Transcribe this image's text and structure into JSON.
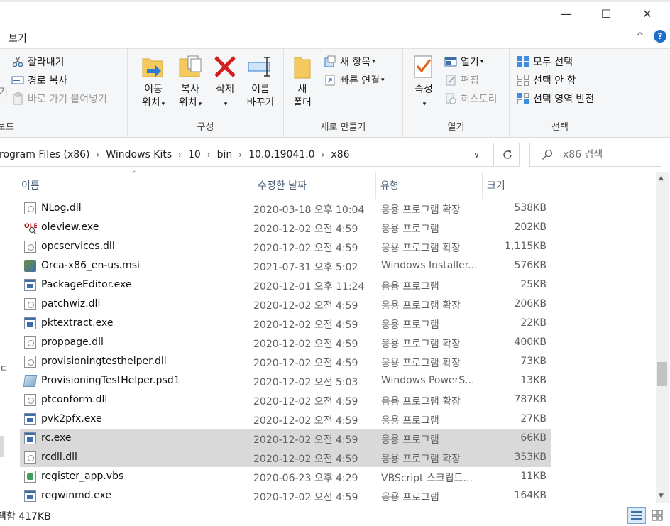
{
  "window": {
    "minimize_glyph": "—",
    "maximize_glyph": "☐",
    "close_glyph": "✕"
  },
  "ribbon_tab": {
    "active": "보기"
  },
  "ribbon": {
    "clipboard": {
      "cut": "잘라내기",
      "copy_path": "경로 복사",
      "paste_shortcut": "바로 가기 붙여넣기",
      "group_label": "보드",
      "partial_left": "기"
    },
    "organize": {
      "move_to_l1": "이동",
      "move_to_l2": "위치",
      "copy_to_l1": "복사",
      "copy_to_l2": "위치",
      "delete": "삭제",
      "rename_l1": "이름",
      "rename_l2": "바꾸기",
      "group_label": "구성"
    },
    "new": {
      "new_item": "새 항목",
      "easy_access": "빠른 연결",
      "new_folder_l1": "새",
      "new_folder_l2": "폴더",
      "group_label": "새로 만들기"
    },
    "open": {
      "properties": "속성",
      "open": "열기",
      "edit": "편집",
      "history": "히스토리",
      "group_label": "열기"
    },
    "select": {
      "select_all": "모두 선택",
      "select_none": "선택 안 함",
      "invert": "선택 영역 반전",
      "group_label": "선택"
    }
  },
  "address": {
    "crumbs": [
      "rogram Files (x86)",
      "Windows Kits",
      "10",
      "bin",
      "10.0.19041.0",
      "x86"
    ],
    "search_placeholder": "x86 검색"
  },
  "columns": {
    "name": "이름",
    "date": "수정한 날짜",
    "type": "유형",
    "size": "크기"
  },
  "files": [
    {
      "name": "NLog.dll",
      "date": "2020-03-18 오후 10:04",
      "type": "응용 프로그램 확장",
      "size": "538KB",
      "icon": "dll-icon",
      "selected": false
    },
    {
      "name": "oleview.exe",
      "date": "2020-12-02 오전 4:59",
      "type": "응용 프로그램",
      "size": "202KB",
      "icon": "oleview-icon",
      "selected": false
    },
    {
      "name": "opcservices.dll",
      "date": "2020-12-02 오전 4:59",
      "type": "응용 프로그램 확장",
      "size": "1,115KB",
      "icon": "dll-icon",
      "selected": false
    },
    {
      "name": "Orca-x86_en-us.msi",
      "date": "2021-07-31 오후 5:02",
      "type": "Windows Installer...",
      "size": "576KB",
      "icon": "msi-icon",
      "selected": false
    },
    {
      "name": "PackageEditor.exe",
      "date": "2020-12-01 오후 11:24",
      "type": "응용 프로그램",
      "size": "25KB",
      "icon": "exe-icon",
      "selected": false
    },
    {
      "name": "patchwiz.dll",
      "date": "2020-12-02 오전 4:59",
      "type": "응용 프로그램 확장",
      "size": "206KB",
      "icon": "dll-icon",
      "selected": false
    },
    {
      "name": "pktextract.exe",
      "date": "2020-12-02 오전 4:59",
      "type": "응용 프로그램",
      "size": "22KB",
      "icon": "exe-icon",
      "selected": false
    },
    {
      "name": "proppage.dll",
      "date": "2020-12-02 오전 4:59",
      "type": "응용 프로그램 확장",
      "size": "400KB",
      "icon": "dll-icon",
      "selected": false
    },
    {
      "name": "provisioningtesthelper.dll",
      "date": "2020-12-02 오전 4:59",
      "type": "응용 프로그램 확장",
      "size": "73KB",
      "icon": "dll-icon",
      "selected": false
    },
    {
      "name": "ProvisioningTestHelper.psd1",
      "date": "2020-12-02 오전 5:03",
      "type": "Windows PowerS...",
      "size": "13KB",
      "icon": "powershell-icon",
      "selected": false
    },
    {
      "name": "ptconform.dll",
      "date": "2020-12-02 오전 4:59",
      "type": "응용 프로그램 확장",
      "size": "787KB",
      "icon": "dll-icon",
      "selected": false
    },
    {
      "name": "pvk2pfx.exe",
      "date": "2020-12-02 오전 4:59",
      "type": "응용 프로그램",
      "size": "27KB",
      "icon": "exe-icon",
      "selected": false
    },
    {
      "name": "rc.exe",
      "date": "2020-12-02 오전 4:59",
      "type": "응용 프로그램",
      "size": "66KB",
      "icon": "exe-icon",
      "selected": true
    },
    {
      "name": "rcdll.dll",
      "date": "2020-12-02 오전 4:59",
      "type": "응용 프로그램 확장",
      "size": "353KB",
      "icon": "dll-icon",
      "selected": true
    },
    {
      "name": "register_app.vbs",
      "date": "2020-06-23 오후 4:29",
      "type": "VBScript 스크립트...",
      "size": "11KB",
      "icon": "vbs-icon",
      "selected": false
    },
    {
      "name": "regwinmd.exe",
      "date": "2020-12-02 오전 4:59",
      "type": "응용 프로그램",
      "size": "164KB",
      "icon": "exe-icon",
      "selected": false
    }
  ],
  "status": {
    "text": "택함 417KB"
  },
  "side": {
    "letter": "ㅌ"
  }
}
